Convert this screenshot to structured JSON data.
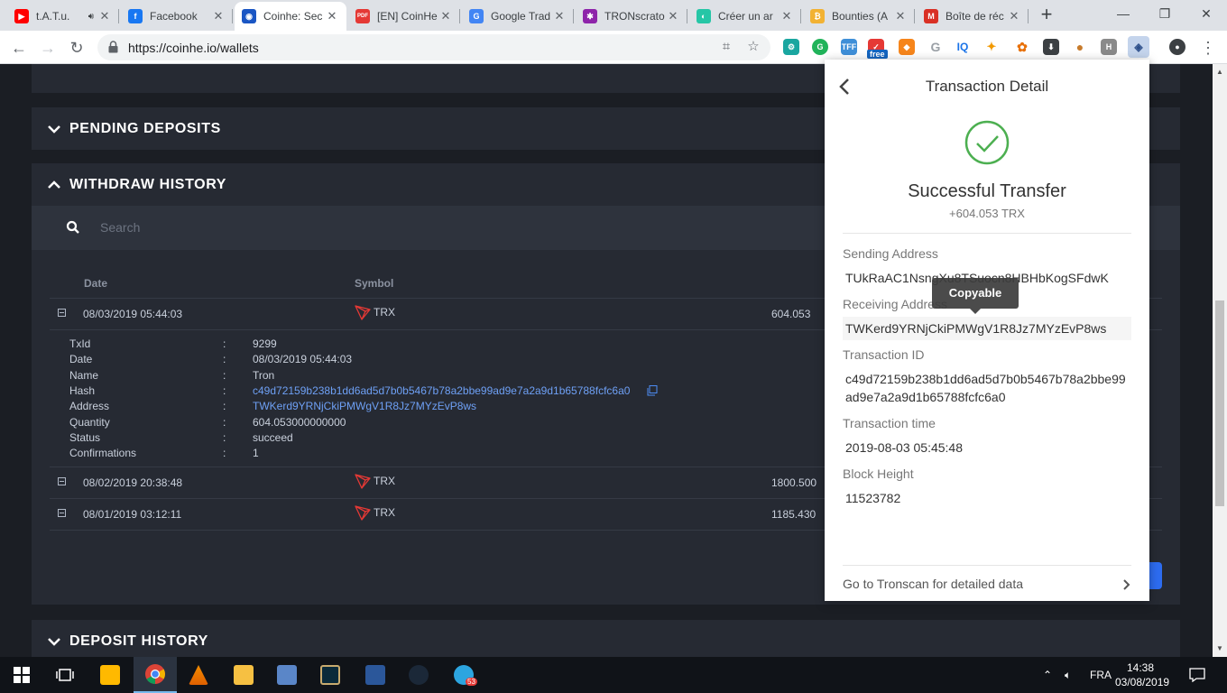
{
  "browser": {
    "tabs": [
      {
        "label": "t.A.T.u.",
        "icon": "youtube-icon",
        "color": "#ff0000",
        "glyph": "▶",
        "extra_icon": "speaker-icon"
      },
      {
        "label": "Facebook",
        "icon": "facebook-icon",
        "color": "#1877f2",
        "glyph": "f"
      },
      {
        "label": "Coinhe: Sec",
        "icon": "coinhe-icon",
        "color": "#1a56c4",
        "glyph": "◉",
        "active": true
      },
      {
        "label": "[EN] CoinHe",
        "icon": "pdf-icon",
        "color": "#e53935",
        "glyph": "PDF"
      },
      {
        "label": "Google Trad",
        "icon": "google-translate-icon",
        "color": "#4285f4",
        "glyph": "G"
      },
      {
        "label": "TRONscrato",
        "icon": "tronscrato-icon",
        "color": "#8e24aa",
        "glyph": "✱"
      },
      {
        "label": "Créer un ar",
        "icon": "creer-icon",
        "color": "#26c6a6",
        "glyph": "◐"
      },
      {
        "label": "Bounties (A",
        "icon": "bitcoin-icon",
        "color": "#f2b233",
        "glyph": "₿"
      },
      {
        "label": "Boîte de réc",
        "icon": "gmail-icon",
        "color": "#d93025",
        "glyph": "M"
      }
    ],
    "url": "https://coinhe.io/wallets",
    "extension_badge": "free"
  },
  "page": {
    "sections": {
      "pending_deposits": "PENDING DEPOSITS",
      "withdraw_history": "WITHDRAW HISTORY",
      "deposit_history": "DEPOSIT HISTORY"
    },
    "search_placeholder": "Search",
    "columns": {
      "date": "Date",
      "symbol": "Symbol"
    },
    "rows": [
      {
        "date": "08/03/2019 05:44:03",
        "symbol": "TRX",
        "amount": "604.053"
      },
      {
        "date": "08/02/2019 20:38:48",
        "symbol": "TRX",
        "amount": "1800.500"
      },
      {
        "date": "08/01/2019 03:12:11",
        "symbol": "TRX",
        "amount": "1185.430"
      }
    ],
    "details": [
      {
        "key": "TxId",
        "value": "9299"
      },
      {
        "key": "Date",
        "value": "08/03/2019 05:44:03"
      },
      {
        "key": "Name",
        "value": "Tron"
      },
      {
        "key": "Hash",
        "value": "c49d72159b238b1dd6ad5d7b0b5467b78a2bbe99ad9e7a2a9d1b65788fcfc6a0"
      },
      {
        "key": "Address",
        "value": "TWKerd9YRNjCkiPMWgV1R8Jz7MYzEvP8ws"
      },
      {
        "key": "Quantity",
        "value": "604.053000000000"
      },
      {
        "key": "Status",
        "value": "succeed"
      },
      {
        "key": "Confirmations",
        "value": "1"
      }
    ],
    "detail_colon": ":"
  },
  "popup": {
    "title": "Transaction Detail",
    "status": "Successful Transfer",
    "amount": "+604.053 TRX",
    "sending_label": "Sending Address",
    "sending_value": "TUkRaAC1NsngXu8TSuocn8HBHbKogSFdwK",
    "receiving_label": "Receiving Address",
    "receiving_value": "TWKerd9YRNjCkiPMWgV1R8Jz7MYzEvP8ws",
    "tooltip": "Copyable",
    "txid_label": "Transaction ID",
    "txid_value_line1": "c49d72159b238b1dd6ad5d7b0b5467b78a2bbe99",
    "txid_value_line2": "ad9e7a2a9d1b65788fcfc6a0",
    "time_label": "Transaction time",
    "time_value": "2019-08-03 05:45:48",
    "height_label": "Block Height",
    "height_value": "11523782",
    "footer_link": "Go to Tronscan for detailed data"
  },
  "taskbar": {
    "language": "FRA",
    "time": "14:38",
    "date": "03/08/2019",
    "telegram_badge": "53"
  },
  "colors": {
    "page_bg": "#1b1e24",
    "panel_bg": "#262a33",
    "tron_red": "#e53935",
    "success_green": "#4caf50",
    "link_blue": "#4d8df6"
  }
}
